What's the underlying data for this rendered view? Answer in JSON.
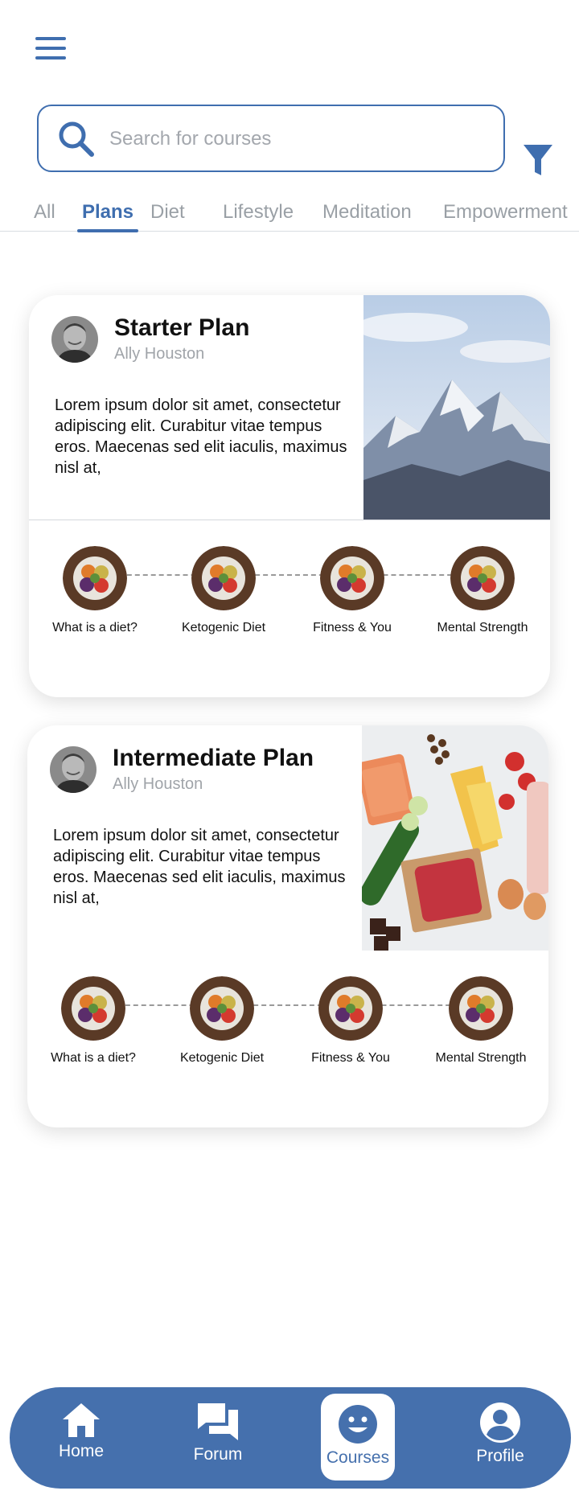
{
  "search": {
    "placeholder": "Search for courses"
  },
  "tabs": [
    {
      "label": "All"
    },
    {
      "label": "Plans",
      "active": true
    },
    {
      "label": "Diet"
    },
    {
      "label": "Lifestyle"
    },
    {
      "label": "Meditation"
    },
    {
      "label": "Empowerment"
    }
  ],
  "plans": [
    {
      "title": "Starter Plan",
      "author": "Ally Houston",
      "description": "Lorem ipsum dolor sit amet, consectetur adipiscing elit. Curabitur vitae tempus eros. Maecenas sed elit iaculis, maximus nisl at,",
      "steps": [
        {
          "label": "What is a diet?"
        },
        {
          "label": "Ketogenic Diet"
        },
        {
          "label": "Fitness & You"
        },
        {
          "label": "Mental Strength"
        }
      ]
    },
    {
      "title": "Intermediate Plan",
      "author": "Ally Houston",
      "description": "Lorem ipsum dolor sit amet, consectetur adipiscing elit. Curabitur vitae tempus eros. Maecenas sed elit iaculis, maximus nisl at,",
      "steps": [
        {
          "label": "What is a diet?"
        },
        {
          "label": "Ketogenic Diet"
        },
        {
          "label": "Fitness & You"
        },
        {
          "label": "Mental Strength"
        }
      ]
    }
  ],
  "nav": {
    "items": [
      {
        "label": "Home",
        "icon": "home-icon"
      },
      {
        "label": "Forum",
        "icon": "forum-icon"
      },
      {
        "label": "Courses",
        "icon": "smiley-icon",
        "active": true
      },
      {
        "label": "Profile",
        "icon": "profile-icon"
      }
    ]
  },
  "colors": {
    "primary": "#3f6eaf",
    "nav": "#4570ad",
    "muted": "#9aa0a6"
  }
}
